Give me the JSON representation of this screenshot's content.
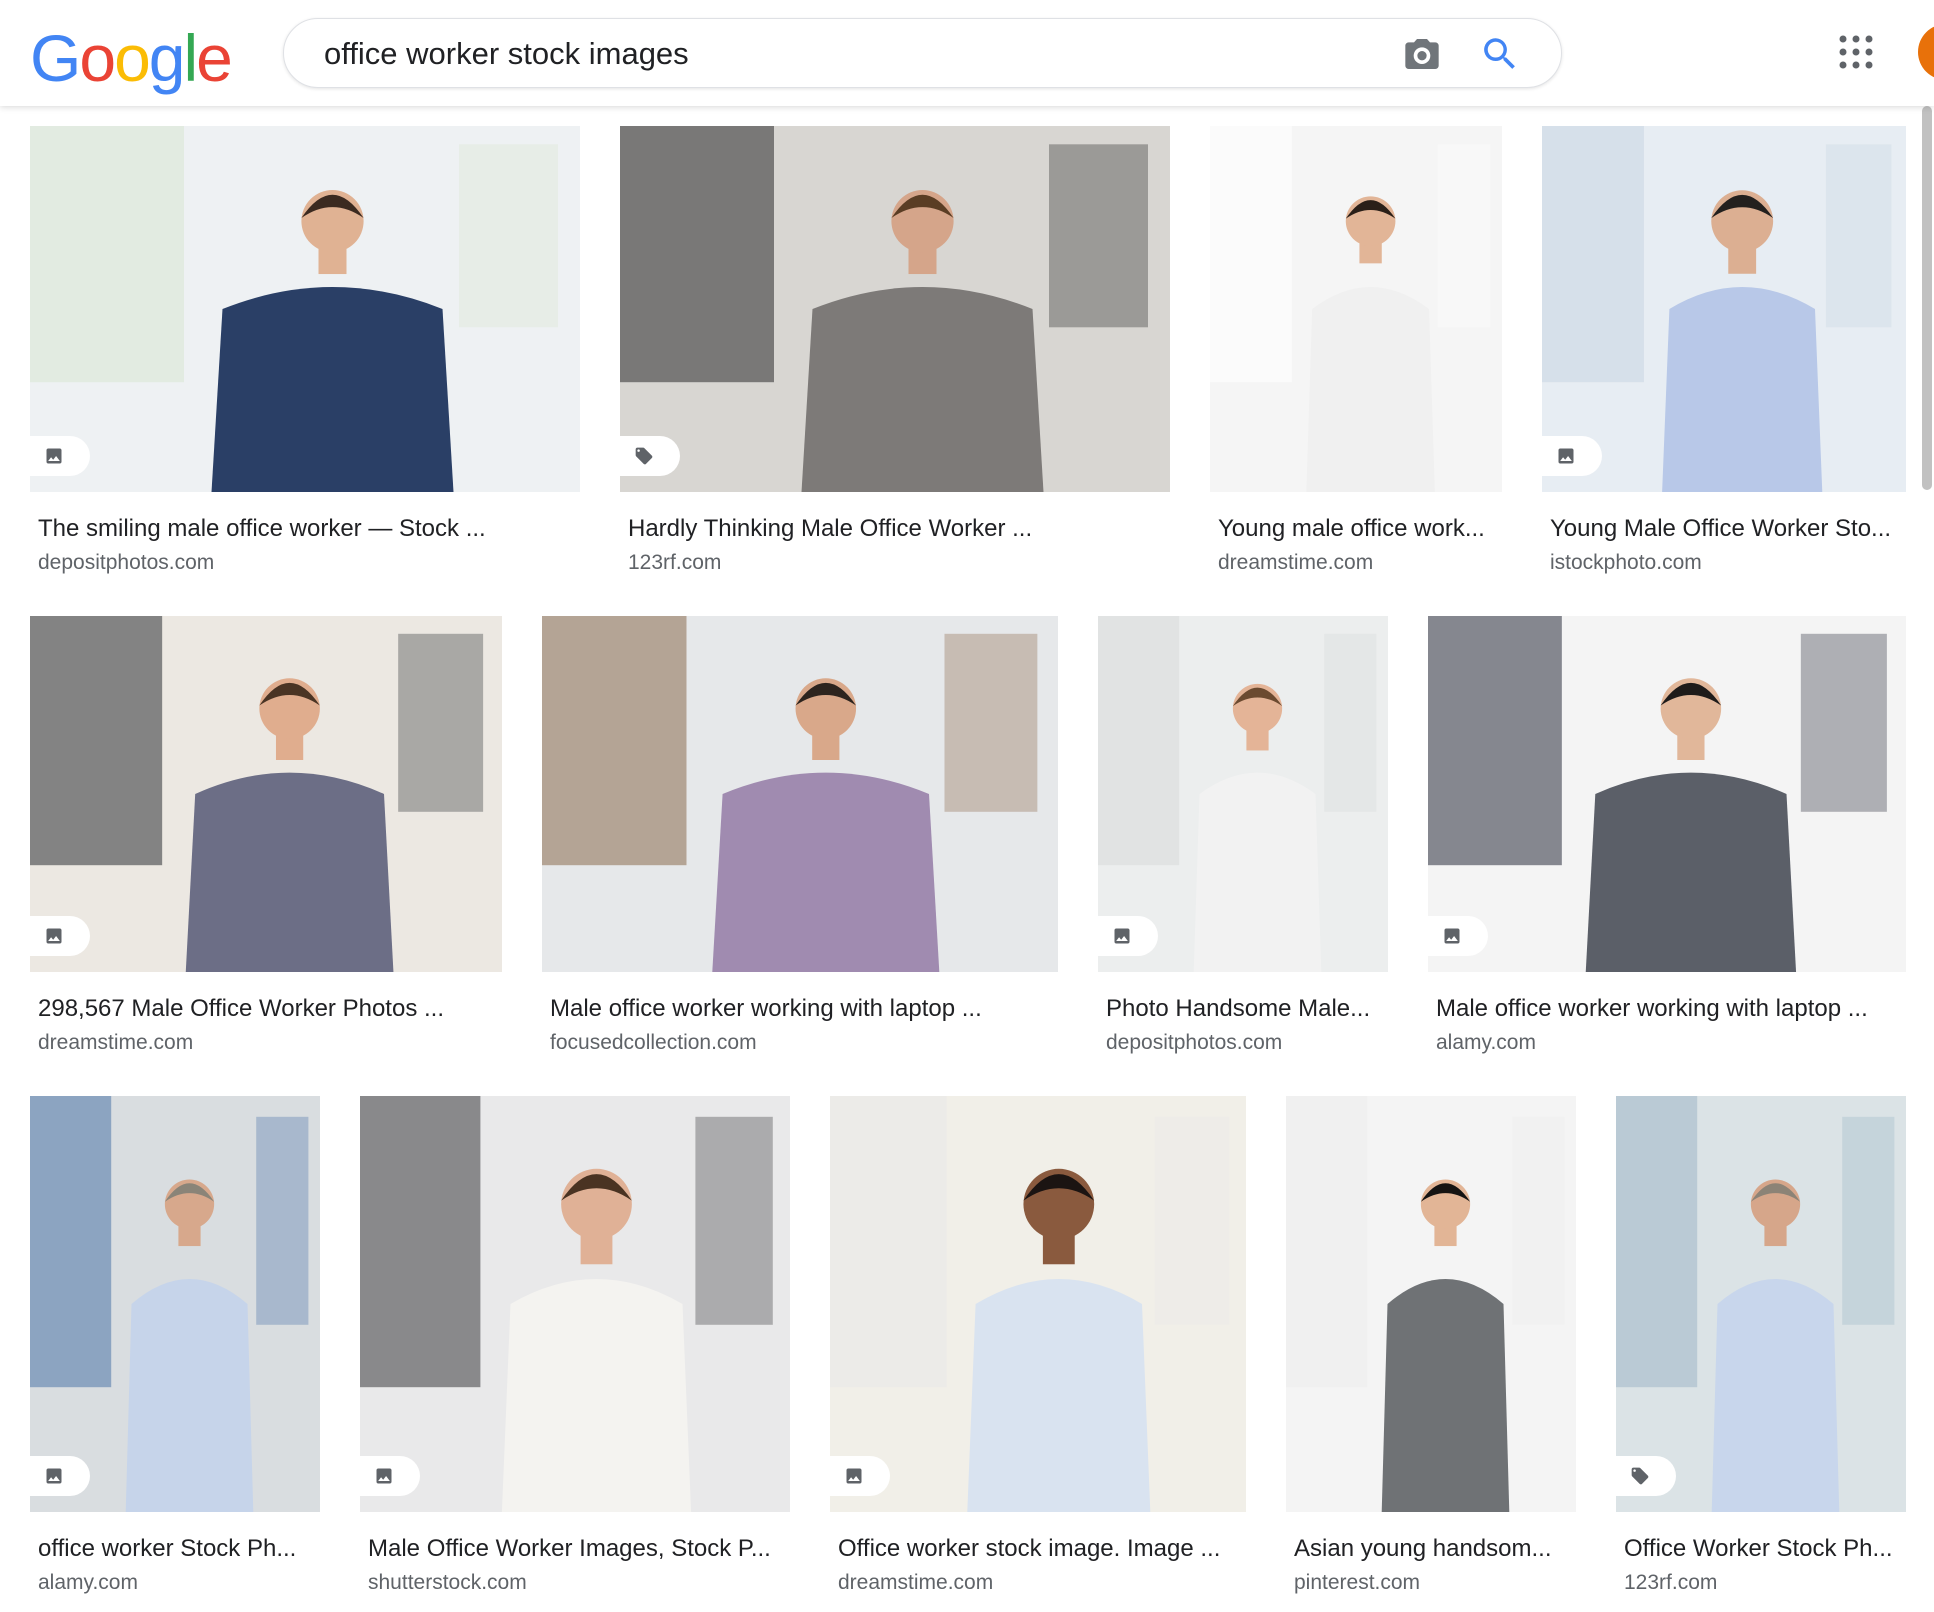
{
  "header": {
    "logo_letters": [
      "G",
      "o",
      "o",
      "g",
      "l",
      "e"
    ],
    "logo_colors": [
      "#4285F4",
      "#EA4335",
      "#FBBC05",
      "#4285F4",
      "#34A853",
      "#EA4335"
    ],
    "search_query": "office worker stock images",
    "camera_icon": "camera-icon",
    "search_icon": "search-icon",
    "apps_icon": "apps-grid-icon"
  },
  "results": [
    {
      "title": "The smiling male office worker — Stock ...",
      "domain": "depositphotos.com",
      "badge": "image-icon",
      "scene": {
        "bg": "#eef1f3",
        "accent": "#d9e6d2",
        "shirt": "#2a3f66",
        "skin": "#e0b293",
        "hair": "#3b2a20"
      }
    },
    {
      "title": "Hardly Thinking Male Office Worker ...",
      "domain": "123rf.com",
      "badge": "tag-icon",
      "scene": {
        "bg": "#d8d6d2",
        "accent": "#2b2b2b",
        "shirt": "#7d7a78",
        "skin": "#d5a58a",
        "hair": "#5a3d24"
      }
    },
    {
      "title": "Young male office work...",
      "domain": "dreamstime.com",
      "badge": "",
      "scene": {
        "bg": "#f5f5f5",
        "accent": "#ffffff",
        "shirt": "#f0f0f0",
        "skin": "#e2b597",
        "hair": "#2a1f18"
      }
    },
    {
      "title": "Young Male Office Worker Sto...",
      "domain": "istockphoto.com",
      "badge": "image-icon",
      "scene": {
        "bg": "#e7edf3",
        "accent": "#c9d6e2",
        "shirt": "#b8c8e8",
        "skin": "#dcaf92",
        "hair": "#23201e"
      }
    },
    {
      "title": "298,567 Male Office Worker Photos ...",
      "domain": "dreamstime.com",
      "badge": "image-icon",
      "scene": {
        "bg": "#ece8e2",
        "accent": "#2e3034",
        "shirt": "#6c6e86",
        "skin": "#e0ad8e",
        "hair": "#4a3424"
      }
    },
    {
      "title": "Male office worker working with laptop ...",
      "domain": "focusedcollection.com",
      "badge": "",
      "scene": {
        "bg": "#e6e8ea",
        "accent": "#8b6b4e",
        "shirt": "#a08bb0",
        "skin": "#d9a88a",
        "hair": "#2d241e"
      }
    },
    {
      "title": "Photo Handsome Male...",
      "domain": "depositphotos.com",
      "badge": "image-icon",
      "scene": {
        "bg": "#eceeee",
        "accent": "#d8dadb",
        "shirt": "#f2f2f2",
        "skin": "#e4b497",
        "hair": "#6b4a30"
      }
    },
    {
      "title": "Male office worker working with laptop ...",
      "domain": "alamy.com",
      "badge": "image-icon",
      "scene": {
        "bg": "#f4f4f4",
        "accent": "#2a2d3c",
        "shirt": "#5b5f68",
        "skin": "#e1b79a",
        "hair": "#1e1b1a"
      }
    },
    {
      "title": "office worker Stock Ph...",
      "domain": "alamy.com",
      "badge": "image-icon",
      "scene": {
        "bg": "#d9dde0",
        "accent": "#4d74a8",
        "shirt": "#c6d4ea",
        "skin": "#d7a88c",
        "hair": "#8a8478"
      }
    },
    {
      "title": "Male Office Worker Images, Stock P...",
      "domain": "shutterstock.com",
      "badge": "image-icon",
      "scene": {
        "bg": "#e9e9ea",
        "accent": "#3a3a3c",
        "shirt": "#f4f3f0",
        "skin": "#e0b196",
        "hair": "#4a3322"
      }
    },
    {
      "title": "Office worker stock image. Image ...",
      "domain": "dreamstime.com",
      "badge": "image-icon",
      "scene": {
        "bg": "#f1efe8",
        "accent": "#e8e8e8",
        "shirt": "#d9e3f0",
        "skin": "#8a5a3e",
        "hair": "#1b1412"
      }
    },
    {
      "title": "Asian young handsom...",
      "domain": "pinterest.com",
      "badge": "",
      "scene": {
        "bg": "#f4f4f4",
        "accent": "#ececec",
        "shirt": "#6f7275",
        "skin": "#e2b596",
        "hair": "#151312"
      }
    },
    {
      "title": "Office Worker Stock Ph...",
      "domain": "123rf.com",
      "badge": "tag-icon",
      "scene": {
        "bg": "#dbe3e6",
        "accent": "#9fb7c6",
        "shirt": "#c8d6ec",
        "skin": "#d6a68a",
        "hair": "#8c8376"
      }
    }
  ]
}
